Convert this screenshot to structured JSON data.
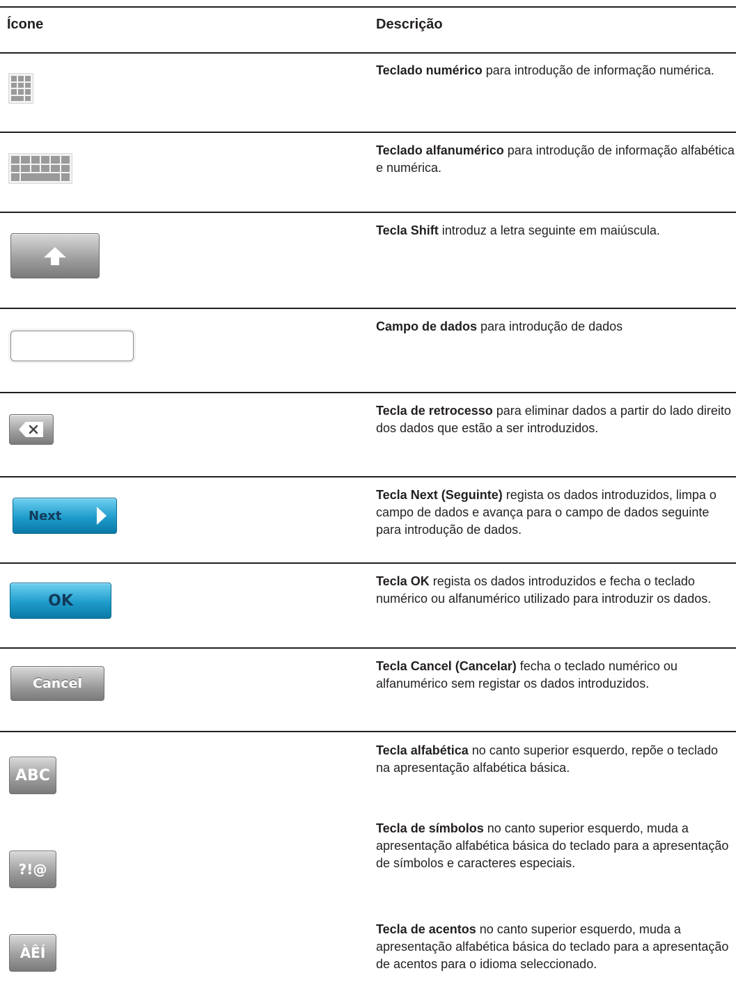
{
  "table": {
    "header_icon": "Ícone",
    "header_description": "Descrição",
    "rows": [
      {
        "icon": "numeric-keypad-icon",
        "term": "Teclado numérico",
        "text": " para introdução de informação numérica."
      },
      {
        "icon": "alphanumeric-keyboard-icon",
        "term": "Teclado alfanumérico",
        "text": " para introdução de informação alfabética e numérica."
      },
      {
        "icon": "shift-key-icon",
        "term": "Tecla Shift",
        "text": " introduz a letra seguinte em maiúscula."
      },
      {
        "icon": "data-field-icon",
        "term": "Campo de dados",
        "text": " para introdução de dados"
      },
      {
        "icon": "backspace-key-icon",
        "term": "Tecla de retrocesso",
        "text": " para eliminar dados a partir do lado direito dos dados que estão a ser introduzidos."
      },
      {
        "icon": "next-key-icon",
        "key_label": "Next",
        "term": "Tecla Next (Seguinte)",
        "text": " regista os dados introduzidos, limpa o campo de dados e avança para o campo de dados seguinte para introdução de dados."
      },
      {
        "icon": "ok-key-icon",
        "key_label": "OK",
        "term": "Tecla OK",
        "text": " regista os dados introduzidos e fecha o teclado numérico ou alfanumérico utilizado para introduzir os dados."
      },
      {
        "icon": "cancel-key-icon",
        "key_label": "Cancel",
        "term": "Tecla Cancel (Cancelar)",
        "text": " fecha o teclado numérico ou alfanumérico sem registar os dados introduzidos."
      },
      {
        "icon": "abc-key-icon",
        "key_label": "ABC",
        "term": "Tecla alfabética",
        "text": " no canto superior esquerdo, repõe o teclado na apresentação alfabética básica."
      },
      {
        "icon": "symbols-key-icon",
        "key_label": "?!@",
        "term": "Tecla de símbolos",
        "text": " no canto superior esquerdo, muda a apresentação alfabética básica do teclado para a apresentação de símbolos e caracteres especiais."
      },
      {
        "icon": "accents-key-icon",
        "key_label": "ÀÊÍ",
        "term": "Tecla de acentos",
        "text": " no canto superior esquerdo, muda a apresentação alfabética básica do teclado para a apresentação de acentos para o idioma seleccionado."
      }
    ]
  }
}
